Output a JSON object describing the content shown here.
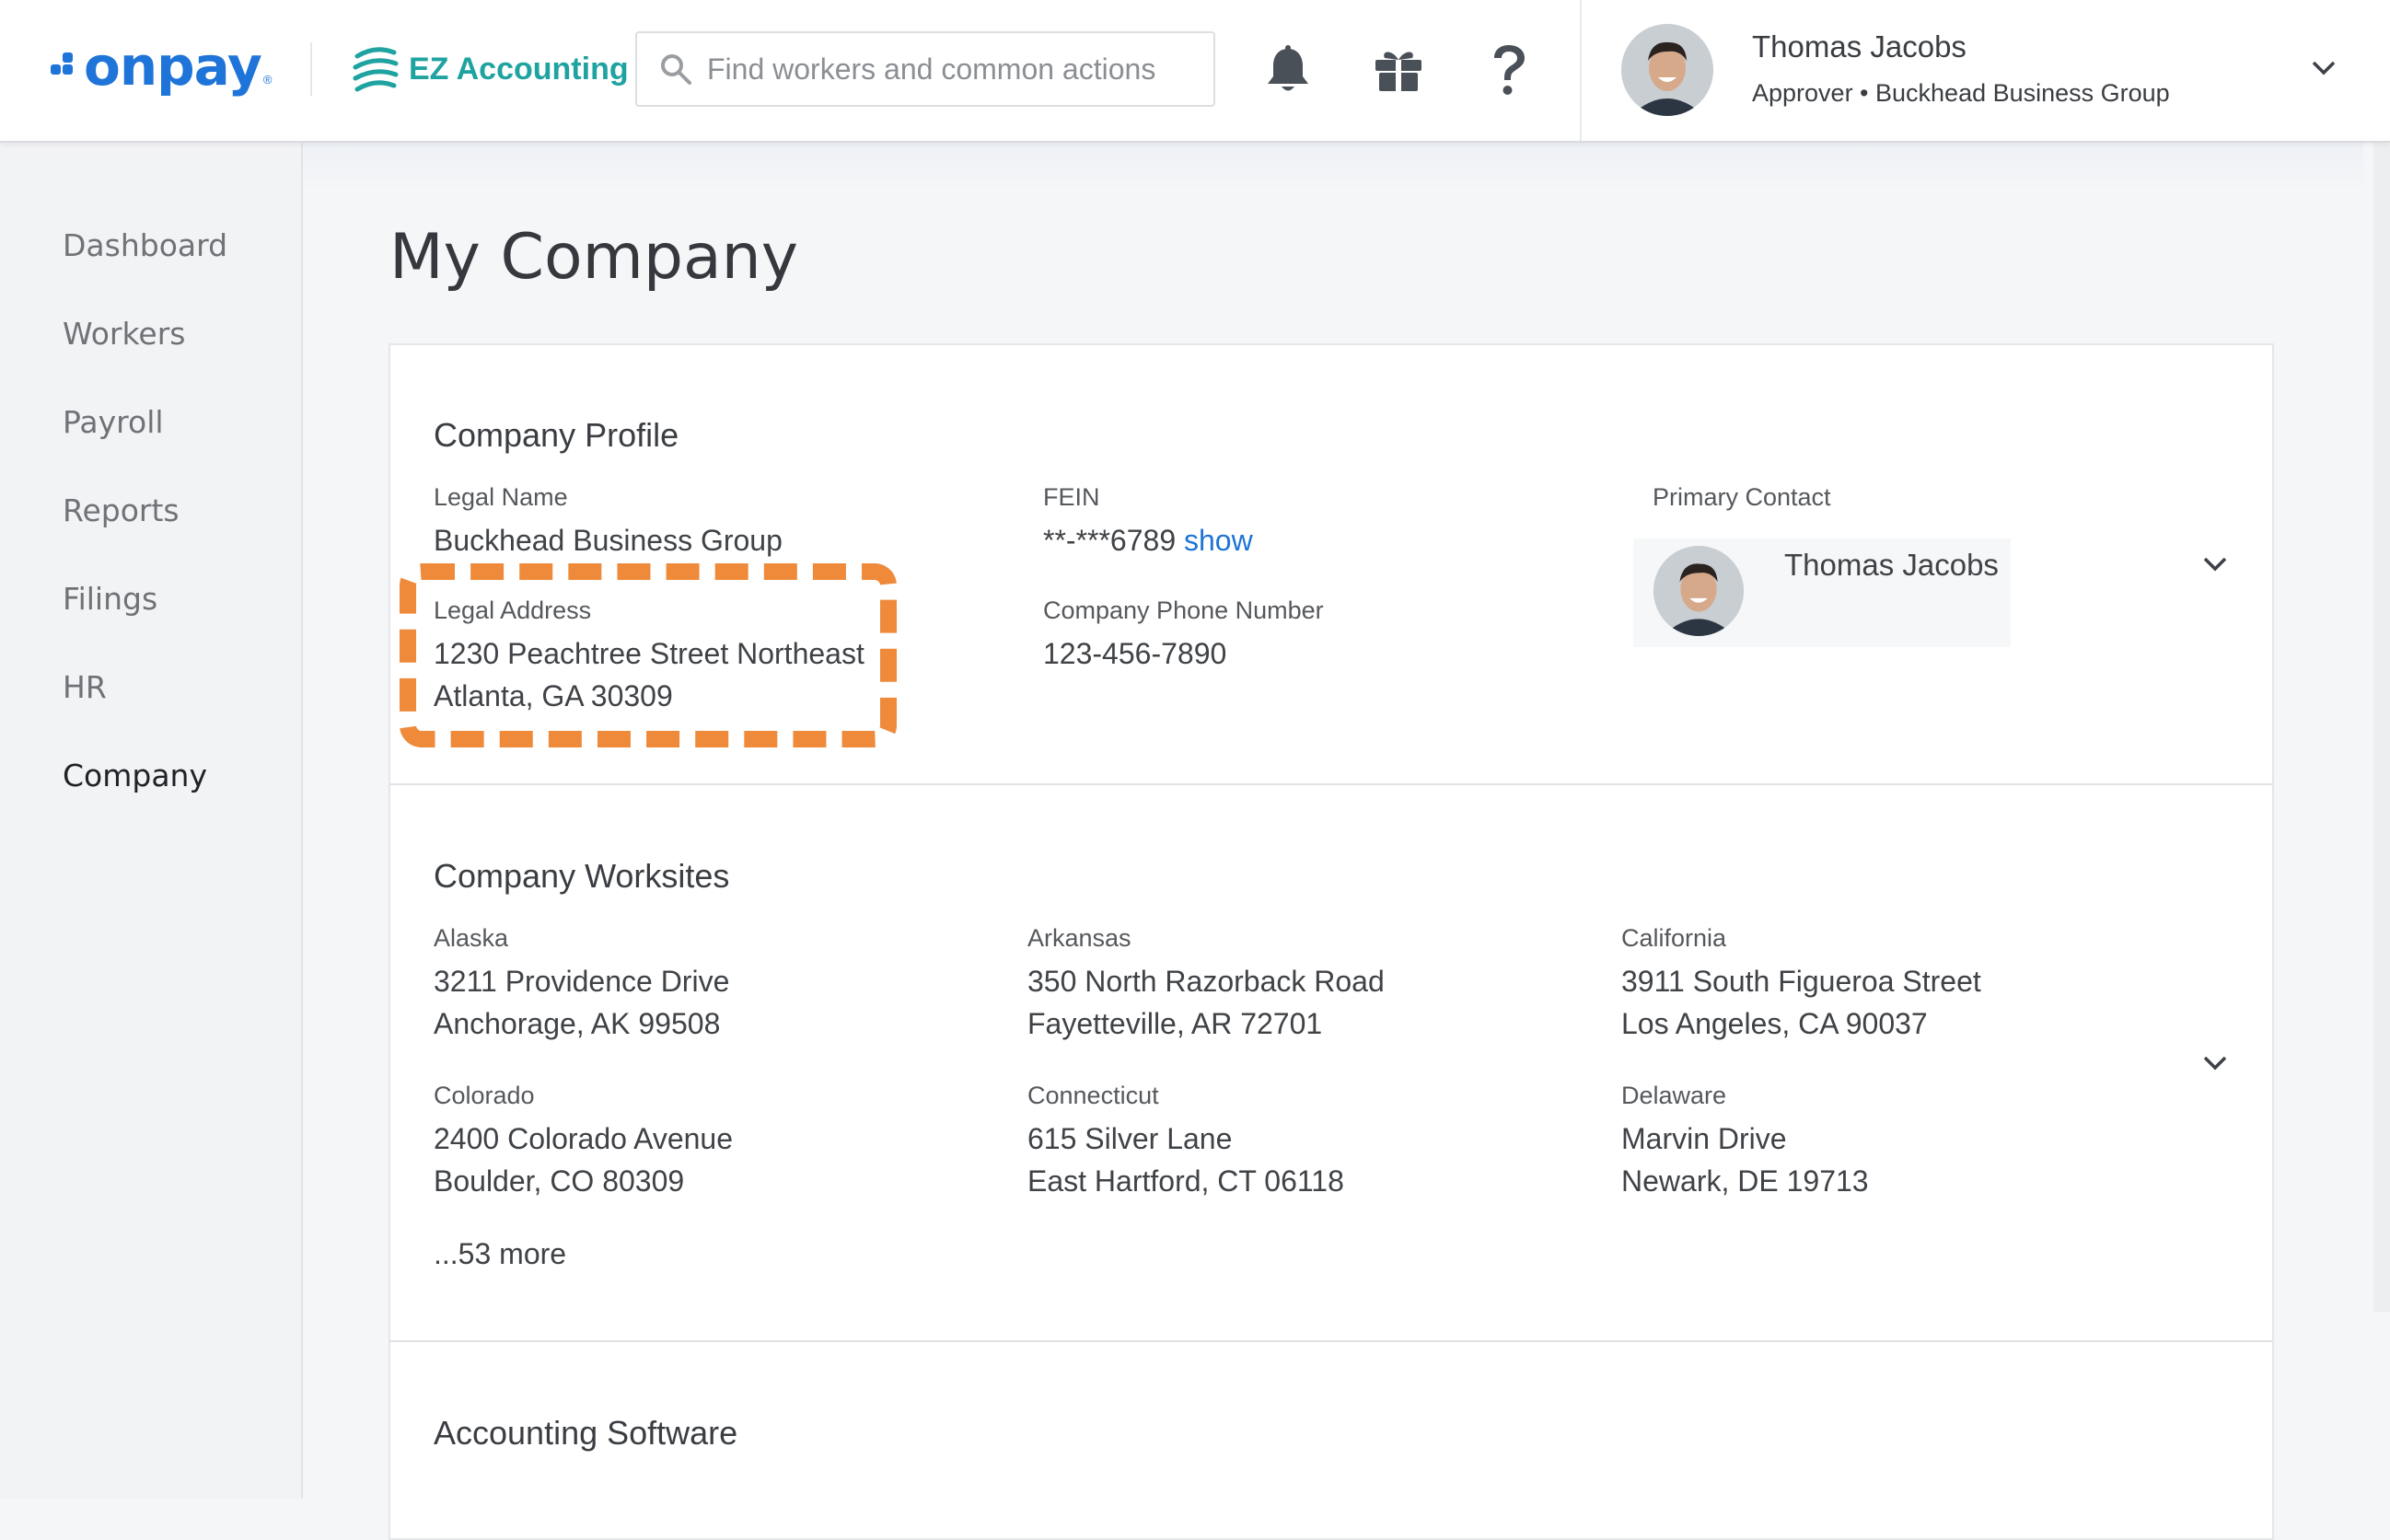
{
  "header": {
    "logo_text": "onpay",
    "logo_reg": "®",
    "ez_label": "EZ Accounting",
    "search_placeholder": "Find workers and common actions",
    "user": {
      "name": "Thomas Jacobs",
      "role": "Approver • Buckhead Business Group"
    }
  },
  "sidebar": {
    "items": [
      {
        "label": "Dashboard"
      },
      {
        "label": "Workers"
      },
      {
        "label": "Payroll"
      },
      {
        "label": "Reports"
      },
      {
        "label": "Filings"
      },
      {
        "label": "HR"
      },
      {
        "label": "Company"
      }
    ],
    "active": "Company"
  },
  "page": {
    "title": "My Company"
  },
  "profile": {
    "title": "Company Profile",
    "legal_name_label": "Legal Name",
    "legal_name": "Buckhead Business Group",
    "legal_address_label": "Legal Address",
    "legal_address_line1": "1230 Peachtree Street Northeast",
    "legal_address_line2": "Atlanta, GA 30309",
    "fein_label": "FEIN",
    "fein_masked": "**-***6789",
    "fein_show": "show",
    "phone_label": "Company Phone Number",
    "phone": "123-456-7890",
    "primary_contact_label": "Primary Contact",
    "primary_contact_name": "Thomas Jacobs"
  },
  "worksites": {
    "title": "Company Worksites",
    "sites": [
      {
        "state": "Alaska",
        "line1": "3211 Providence Drive",
        "line2": "Anchorage, AK 99508"
      },
      {
        "state": "Arkansas",
        "line1": "350 North Razorback Road",
        "line2": "Fayetteville, AR 72701"
      },
      {
        "state": "California",
        "line1": "3911 South Figueroa Street",
        "line2": "Los Angeles, CA 90037"
      },
      {
        "state": "Colorado",
        "line1": "2400 Colorado Avenue",
        "line2": "Boulder, CO 80309"
      },
      {
        "state": "Connecticut",
        "line1": "615 Silver Lane",
        "line2": "East Hartford, CT 06118"
      },
      {
        "state": "Delaware",
        "line1": "Marvin Drive",
        "line2": "Newark, DE 19713"
      }
    ],
    "more": "...53 more"
  },
  "accounting": {
    "title": "Accounting Software"
  },
  "colors": {
    "brand_blue": "#1e74d8",
    "ez_teal": "#1fa3a0",
    "highlight_orange": "#ee8a3a",
    "link_blue": "#1f74d6"
  },
  "icons": [
    "search-icon",
    "bell-icon",
    "gift-icon",
    "help-icon",
    "chevron-down-icon"
  ]
}
